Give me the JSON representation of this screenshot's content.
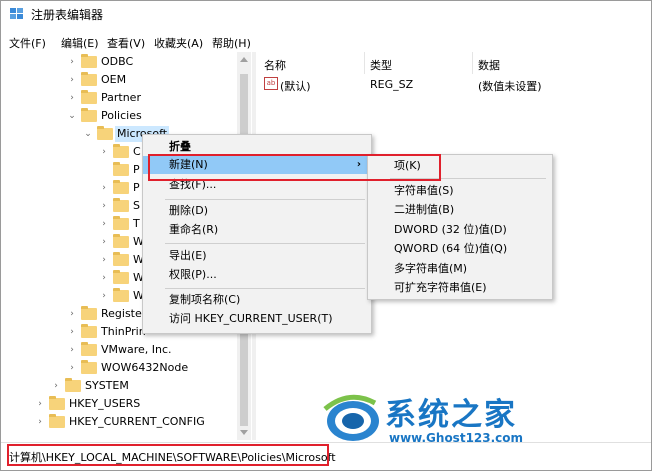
{
  "window": {
    "title": "注册表编辑器"
  },
  "menu": [
    "文件(F)",
    "编辑(E)",
    "查看(V)",
    "收藏夹(A)",
    "帮助(H)"
  ],
  "tree": {
    "nodes": [
      {
        "label": "ODBC",
        "chev": "›"
      },
      {
        "label": "OEM",
        "chev": "›"
      },
      {
        "label": "Partner",
        "chev": "›"
      },
      {
        "label": "Policies",
        "chev": "⌄"
      },
      {
        "label": "Microsoft",
        "chev": "⌄"
      },
      {
        "label": "C",
        "chev": "›"
      },
      {
        "label": "P",
        "chev": ""
      },
      {
        "label": "P",
        "chev": "›"
      },
      {
        "label": "S",
        "chev": "›"
      },
      {
        "label": "T",
        "chev": "›"
      },
      {
        "label": "W",
        "chev": "›"
      },
      {
        "label": "W",
        "chev": "›"
      },
      {
        "label": "W",
        "chev": "›"
      },
      {
        "label": "W",
        "chev": "›"
      },
      {
        "label": "Register",
        "chev": "›"
      },
      {
        "label": "ThinPrin",
        "chev": "›"
      },
      {
        "label": "VMware, Inc.",
        "chev": "›"
      },
      {
        "label": "WOW6432Node",
        "chev": "›"
      },
      {
        "label": "SYSTEM",
        "chev": "›"
      },
      {
        "label": "HKEY_USERS",
        "chev": "›"
      },
      {
        "label": "HKEY_CURRENT_CONFIG",
        "chev": "›"
      }
    ]
  },
  "list": {
    "headers": {
      "name": "名称",
      "type": "类型",
      "data": "数据"
    },
    "rows": [
      {
        "icon": "ab",
        "name": "(默认)",
        "type": "REG_SZ",
        "data": "(数值未设置)"
      }
    ]
  },
  "context_menu": {
    "items": [
      "折叠",
      "新建(N)",
      "查找(F)...",
      "删除(D)",
      "重命名(R)",
      "导出(E)",
      "权限(P)...",
      "复制项名称(C)",
      "访问 HKEY_CURRENT_USER(T)"
    ],
    "submenu_arrow": "›"
  },
  "submenu": {
    "items": [
      "项(K)",
      "字符串值(S)",
      "二进制值(B)",
      "DWORD (32 位)值(D)",
      "QWORD (64 位)值(Q)",
      "多字符串值(M)",
      "可扩充字符串值(E)"
    ]
  },
  "status": {
    "path": "计算机\\HKEY_LOCAL_MACHINE\\SOFTWARE\\Policies\\Microsoft"
  },
  "watermark": {
    "brand": "系统之家",
    "url": "www.Ghost123.com"
  },
  "colors": {
    "highlight": "#91c9f7",
    "selection": "#cce8ff",
    "annotation": "#e0202c",
    "brand": "#1976c4"
  }
}
